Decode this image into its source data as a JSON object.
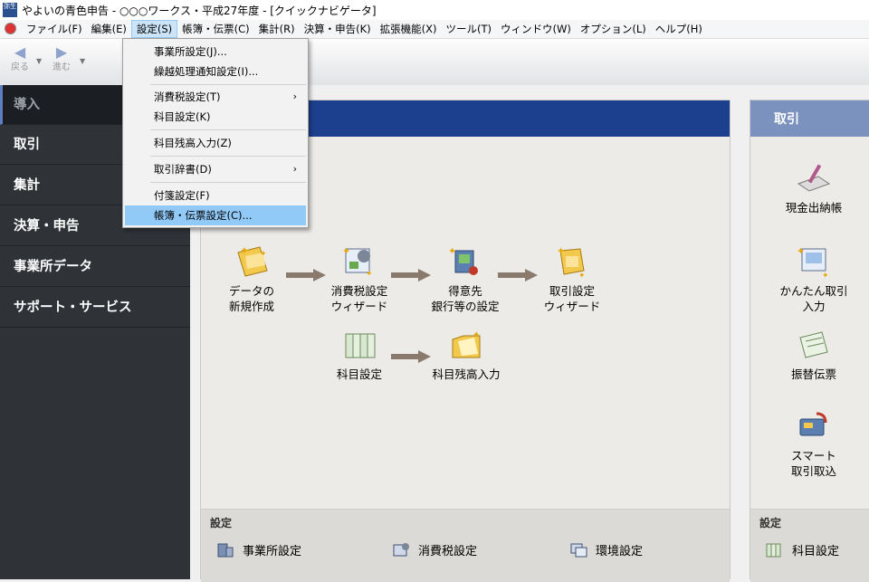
{
  "window": {
    "title": "やよいの青色申告 - ○○○ワークス・平成27年度 - [クイックナビゲータ]",
    "icon_text": "弥生"
  },
  "menubar": {
    "items": [
      {
        "label": "ファイル(F)"
      },
      {
        "label": "編集(E)"
      },
      {
        "label": "設定(S)",
        "active": true
      },
      {
        "label": "帳簿・伝票(C)"
      },
      {
        "label": "集計(R)"
      },
      {
        "label": "決算・申告(K)"
      },
      {
        "label": "拡張機能(X)"
      },
      {
        "label": "ツール(T)"
      },
      {
        "label": "ウィンドウ(W)"
      },
      {
        "label": "オプション(L)"
      },
      {
        "label": "ヘルプ(H)"
      }
    ]
  },
  "toolbar": {
    "back_label": "戻る",
    "forward_label": "進む"
  },
  "dropdown": {
    "items": [
      {
        "label": "事業所設定(J)..."
      },
      {
        "label": "繰越処理通知設定(I)..."
      },
      {
        "label": "消費税設定(T)",
        "submenu": true
      },
      {
        "label": "科目設定(K)"
      },
      {
        "label": "科目残高入力(Z)"
      },
      {
        "label": "取引辞書(D)",
        "submenu": true
      },
      {
        "label": "付箋設定(F)"
      },
      {
        "label": "帳簿・伝票設定(C)...",
        "highlighted": true
      }
    ],
    "submenu_glyph": "›"
  },
  "sidebar": {
    "items": [
      {
        "label": "導入",
        "current": true
      },
      {
        "label": "取引"
      },
      {
        "label": "集計"
      },
      {
        "label": "決算・申告"
      },
      {
        "label": "事業所データ"
      },
      {
        "label": "サポート・サービス"
      }
    ]
  },
  "workflow": {
    "new_data": "データの\n新規作成",
    "tax_wizard": "消費税設定\nウィザード",
    "bank_setup": "得意先\n銀行等の設定",
    "trade_wizard": "取引設定\nウィザード",
    "account_setup": "科目設定",
    "balance_input": "科目残高入力"
  },
  "settings_strip": {
    "title": "設定",
    "links": [
      {
        "label": "事業所設定"
      },
      {
        "label": "消費税設定"
      },
      {
        "label": "環境設定"
      }
    ]
  },
  "trade_panel": {
    "title": "取引",
    "items": [
      {
        "label": "現金出納帳"
      },
      {
        "label": "かんたん取引\n入力"
      },
      {
        "label": "振替伝票"
      },
      {
        "label": "スマート\n取引取込"
      }
    ],
    "settings_title": "設定",
    "settings_link": "科目設定"
  },
  "colors": {
    "sidebar_bg": "#2f3338",
    "panel_header": "#1c3f8e",
    "trade_header": "#7b92be",
    "menu_highlight": "#91c9f7"
  }
}
